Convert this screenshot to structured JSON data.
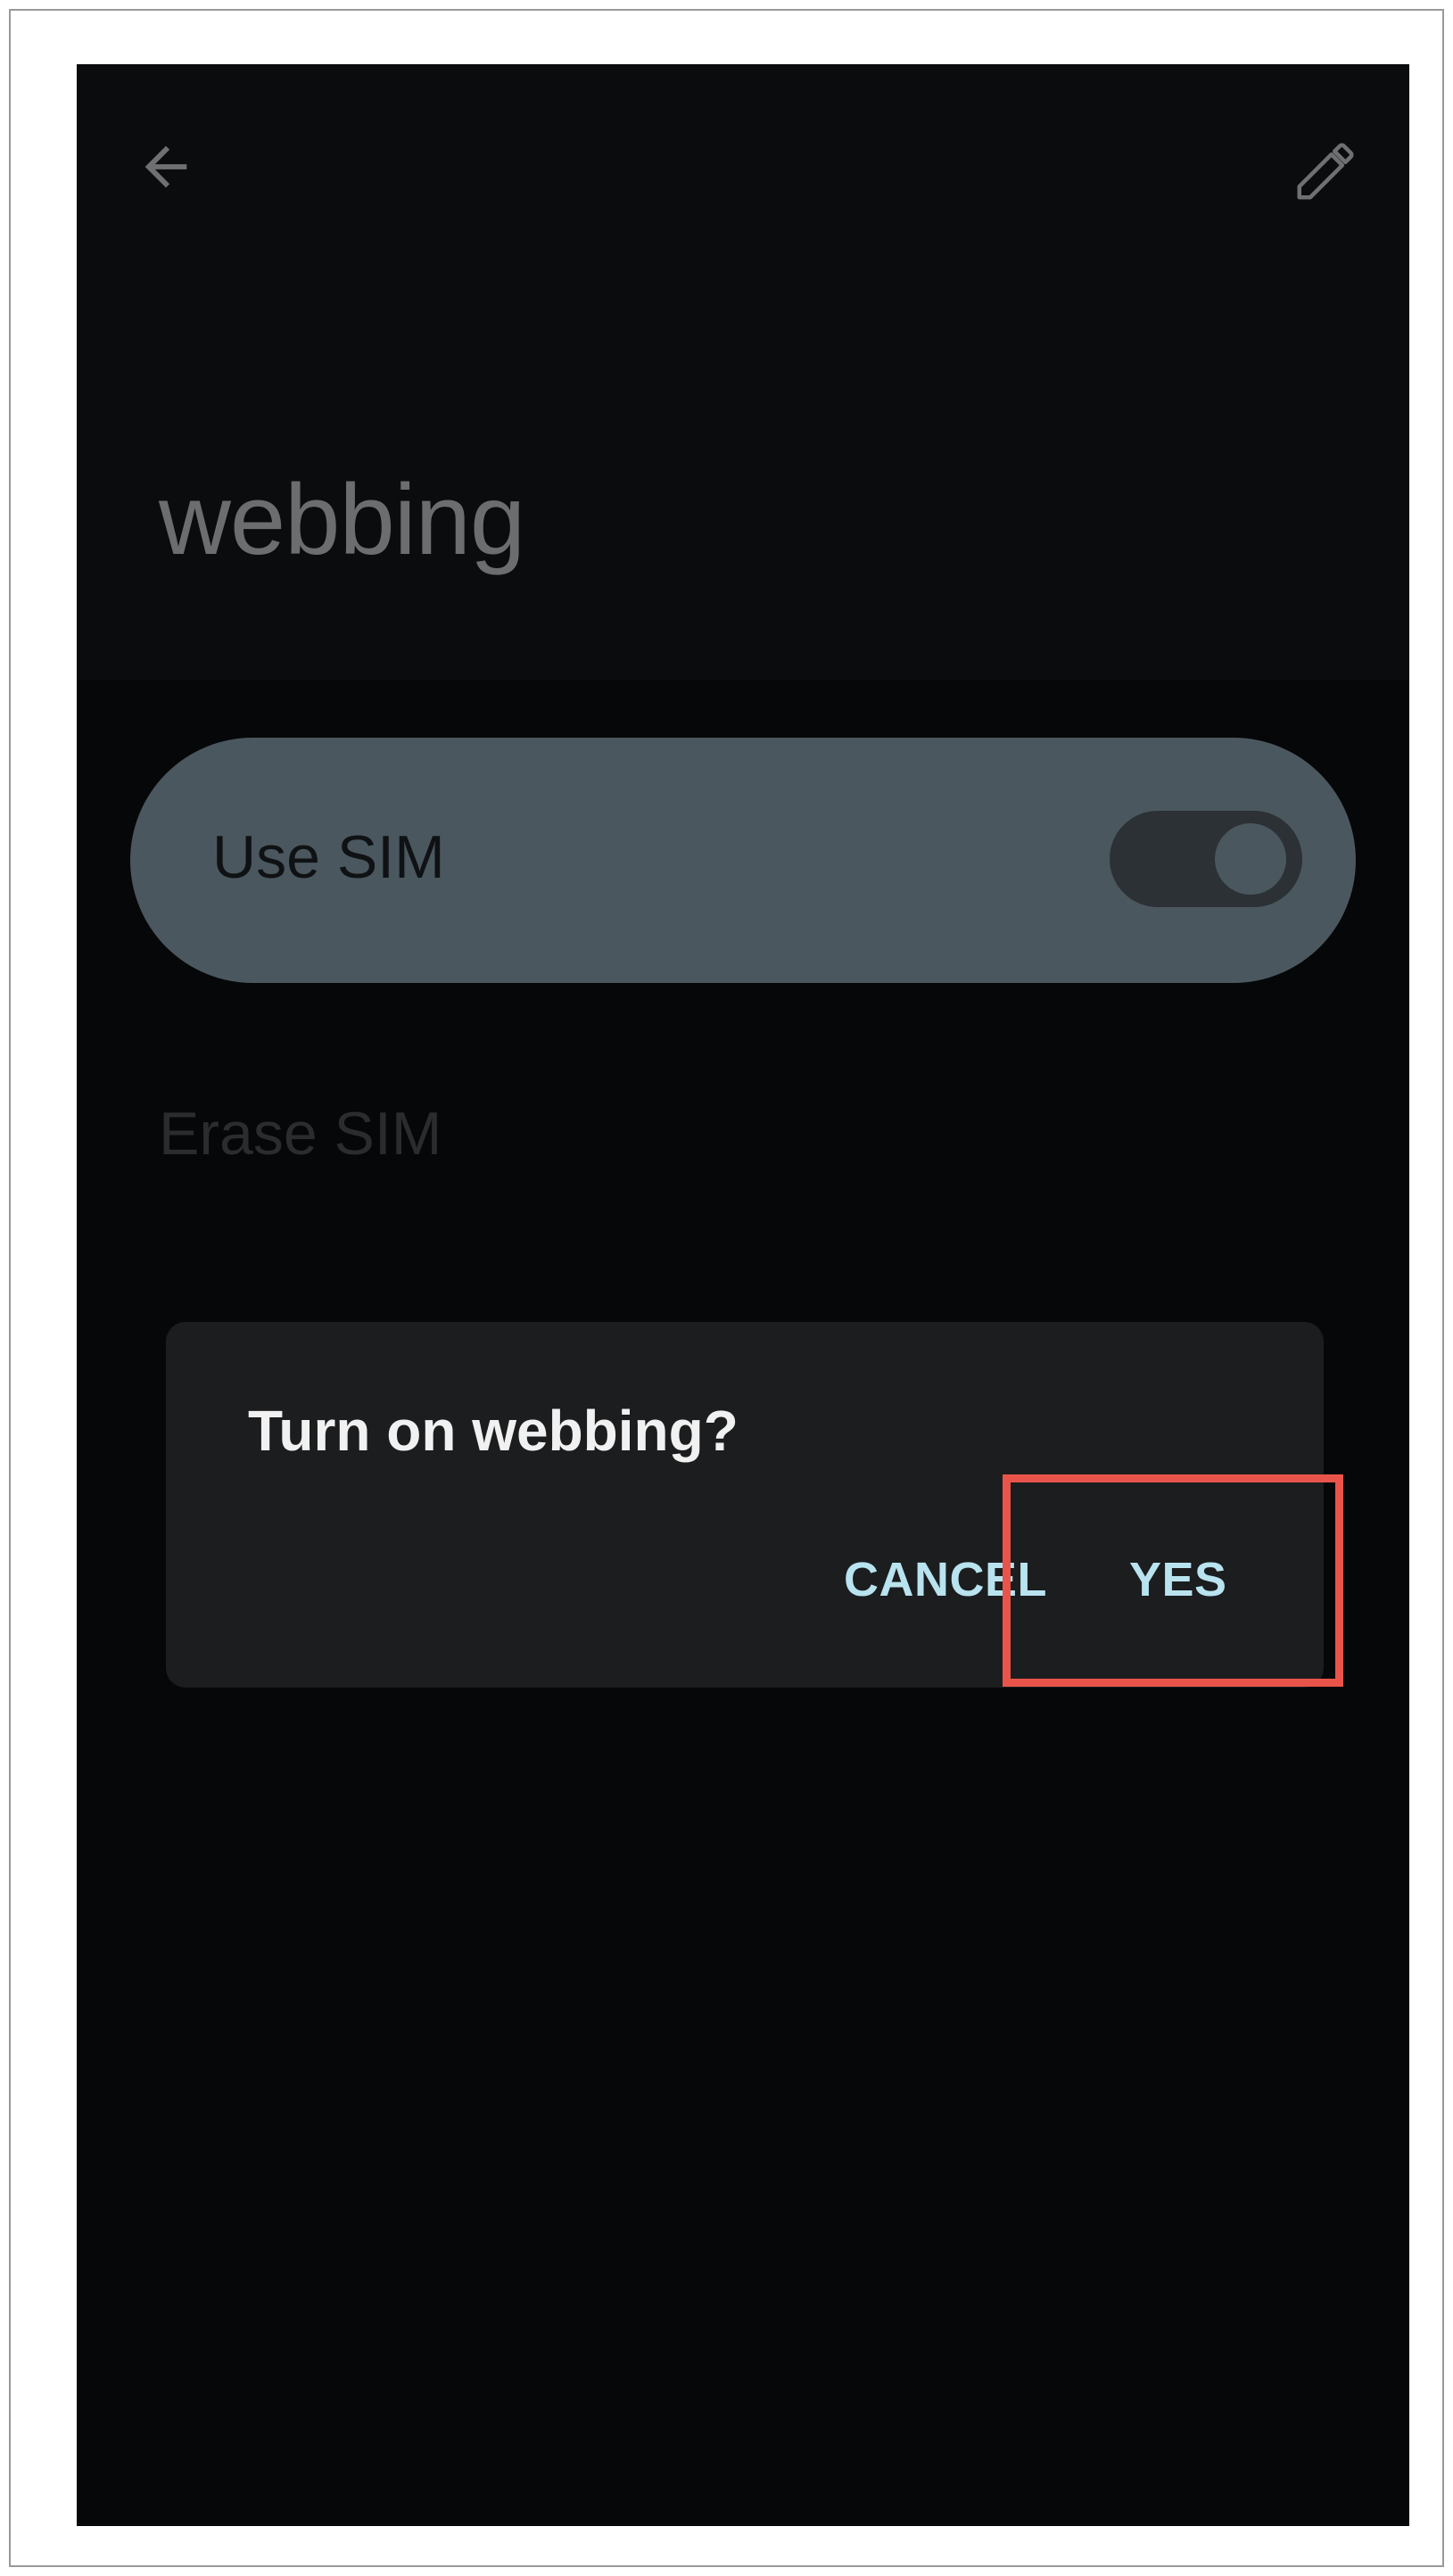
{
  "app_bar": {
    "back_icon": "arrow-back-icon",
    "edit_icon": "pencil-edit-icon",
    "title": "webbing"
  },
  "settings": {
    "use_sim_label": "Use SIM",
    "use_sim_toggle_on": true,
    "erase_sim_label": "Erase SIM"
  },
  "dialog": {
    "title": "Turn on webbing?",
    "cancel_label": "CANCEL",
    "yes_label": "YES"
  },
  "colors": {
    "screen_background": "#060708",
    "card": "#4b575e",
    "dialog": "#1b1d1f",
    "button_text": "#b8e3ef",
    "highlight": "#e9544a"
  }
}
